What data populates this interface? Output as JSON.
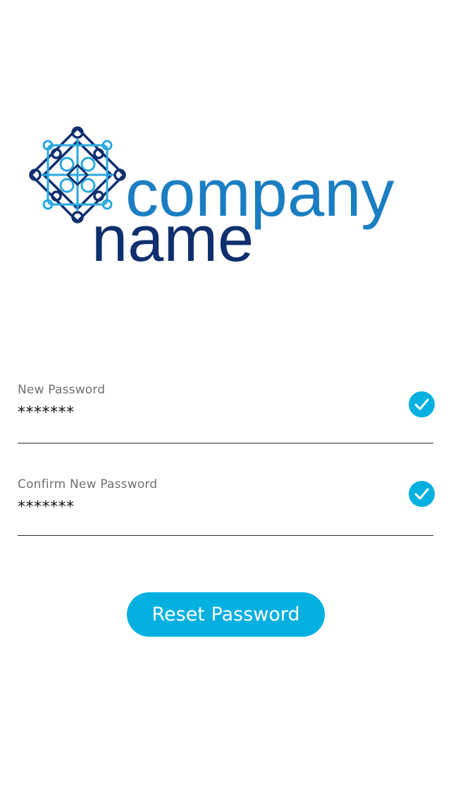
{
  "logo": {
    "word1": "company",
    "word2": "name",
    "colors": {
      "word1": "#1b7ec2",
      "word2": "#0f2f6e",
      "knot_outer": "#0f2f6e",
      "knot_inner": "#29a8e0"
    }
  },
  "form": {
    "new_password": {
      "label": "New Password",
      "value": "*******",
      "status_icon": "check-circle-icon"
    },
    "confirm_password": {
      "label": "Confirm New Password",
      "value": "*******",
      "status_icon": "check-circle-icon"
    }
  },
  "reset_button": {
    "label": "Reset Password"
  },
  "colors": {
    "accent": "#04b0e0",
    "label": "#6f6f6f",
    "text": "#111111",
    "divider": "#2a2a2a"
  }
}
